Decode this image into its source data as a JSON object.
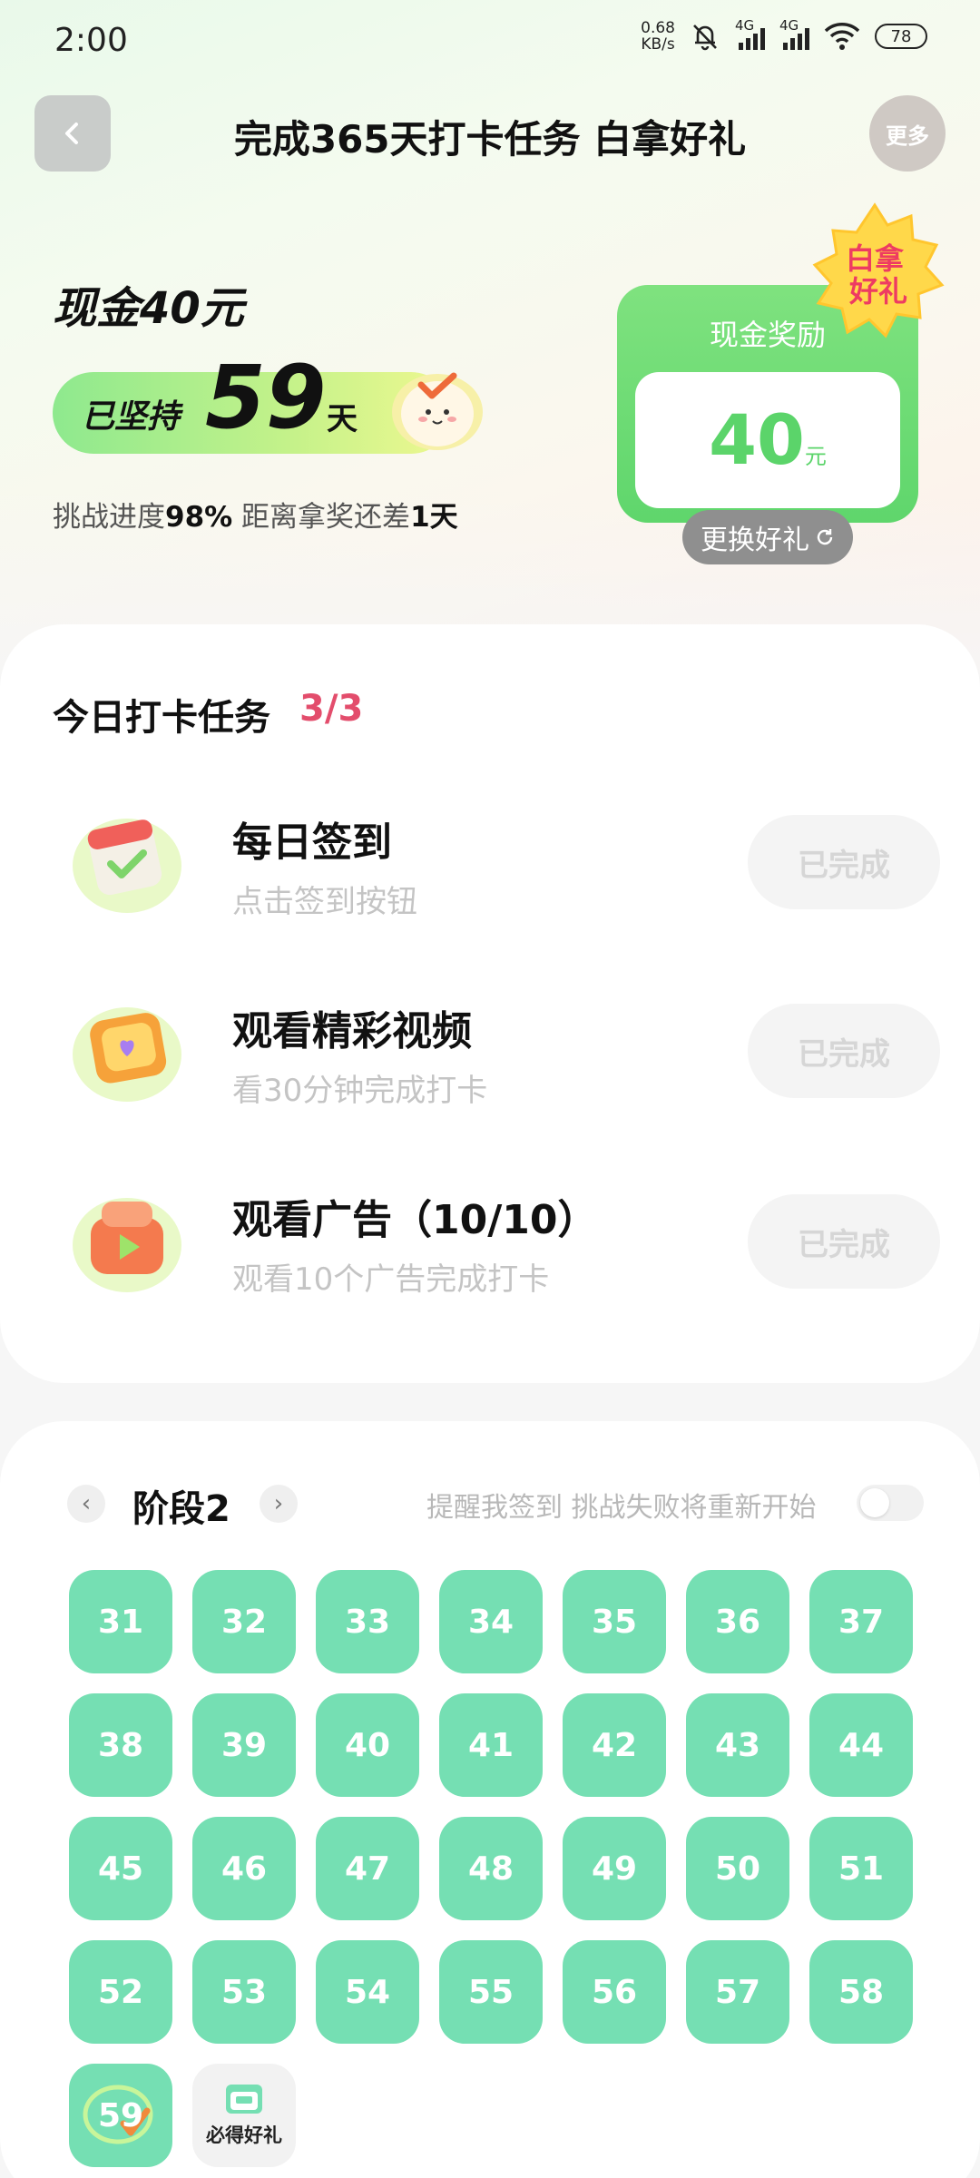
{
  "status_bar": {
    "time": "2:00",
    "net_speed_value": "0.68",
    "net_speed_unit": "KB/s",
    "sim1": "4G",
    "sim2": "4G",
    "battery": "78"
  },
  "header": {
    "title": "完成365天打卡任务 白拿好礼",
    "more_label": "更多"
  },
  "hero": {
    "cash_title": "现金40元",
    "streak_prefix": "已坚持",
    "streak_days": "59",
    "streak_suffix": "天",
    "progress_label_1": "挑战进度",
    "progress_percent": "98%",
    "progress_label_2": " 距离拿奖还差",
    "remaining": "1天"
  },
  "reward": {
    "title": "现金奖励",
    "amount": "40",
    "unit": "元",
    "badge_line1": "白拿",
    "badge_line2": "好礼",
    "change_label": "更换好礼"
  },
  "tasks": {
    "heading": "今日打卡任务",
    "count": "3/3",
    "items": [
      {
        "title": "每日签到",
        "subtitle": "点击签到按钮",
        "button": "已完成"
      },
      {
        "title": "观看精彩视频",
        "subtitle": "看30分钟完成打卡",
        "button": "已完成"
      },
      {
        "title": "观看广告（10/10）",
        "subtitle": "观看10个广告完成打卡",
        "button": "已完成"
      }
    ]
  },
  "calendar": {
    "stage_label": "阶段2",
    "remind_text": "提醒我签到 挑战失败将重新开始",
    "days": [
      "31",
      "32",
      "33",
      "34",
      "35",
      "36",
      "37",
      "38",
      "39",
      "40",
      "41",
      "42",
      "43",
      "44",
      "45",
      "46",
      "47",
      "48",
      "49",
      "50",
      "51",
      "52",
      "53",
      "54",
      "55",
      "56",
      "57",
      "58"
    ],
    "today": "59",
    "gift_label": "必得好礼"
  },
  "colors": {
    "accent_green": "#75dfb3",
    "reward_green": "#5fd66c",
    "count_red": "#e34d6c",
    "badge_yellow": "#ffd84a"
  }
}
